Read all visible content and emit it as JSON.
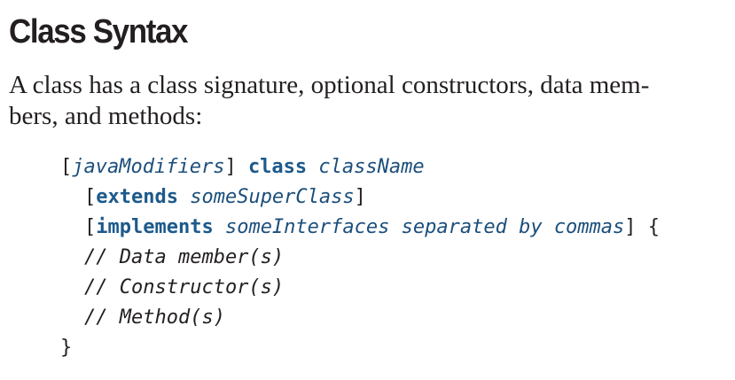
{
  "heading": "Class Syntax",
  "paragraph": {
    "line1": "A class has a class signature, optional constructors, data mem-",
    "line2": "bers, and methods:"
  },
  "code": {
    "line1": {
      "open_bracket": "[",
      "modifiers": "javaModifiers",
      "close_bracket": "]",
      "keyword_class": "class",
      "class_name": "className"
    },
    "line2": {
      "open_bracket": "[",
      "keyword_extends": "extends",
      "super_class": "someSuperClass",
      "close_bracket": "]"
    },
    "line3": {
      "open_bracket": "[",
      "keyword_implements": "implements",
      "interfaces": "someInterfaces separated by commas",
      "close_bracket": "]",
      "open_brace": "{"
    },
    "comment1": "// Data member(s)",
    "comment2": "// Constructor(s)",
    "comment3": "// Method(s)",
    "close_brace": "}"
  }
}
